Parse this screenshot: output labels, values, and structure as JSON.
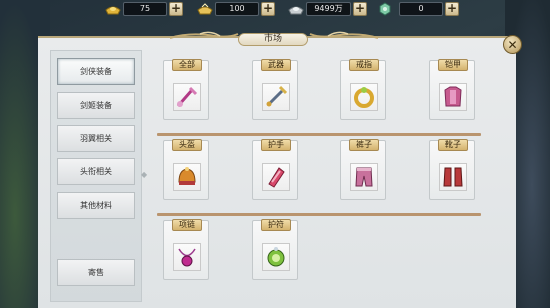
{
  "currencies": [
    {
      "name": "gold-ingot",
      "value": "75",
      "color": "#e0b43a"
    },
    {
      "name": "gold-ingot-bound",
      "value": "100",
      "color": "#e6c25a"
    },
    {
      "name": "silver",
      "value": "9499万",
      "color": "#c9ced2"
    },
    {
      "name": "jade-token",
      "value": "0",
      "color": "#7ec9a6"
    }
  ],
  "plus_label": "+",
  "window": {
    "title": "市场",
    "close_label": "✕"
  },
  "sidebar": {
    "items": [
      {
        "label": "剑侠装备"
      },
      {
        "label": "剑姬装备"
      },
      {
        "label": "羽翼相关"
      },
      {
        "label": "头衔相关"
      },
      {
        "label": "其他材料"
      }
    ],
    "sell_label": "寄售"
  },
  "categories": [
    {
      "label": "全部",
      "icon": "sword-icon"
    },
    {
      "label": "武器",
      "icon": "dagger-icon"
    },
    {
      "label": "戒指",
      "icon": "ring-icon"
    },
    {
      "label": "铠甲",
      "icon": "armor-icon"
    },
    {
      "label": "头盔",
      "icon": "helmet-icon"
    },
    {
      "label": "护手",
      "icon": "gauntlet-icon"
    },
    {
      "label": "裤子",
      "icon": "pants-icon"
    },
    {
      "label": "靴子",
      "icon": "boots-icon"
    },
    {
      "label": "项链",
      "icon": "necklace-icon"
    },
    {
      "label": "护符",
      "icon": "amulet-icon"
    }
  ],
  "scroll_marker": "◆"
}
